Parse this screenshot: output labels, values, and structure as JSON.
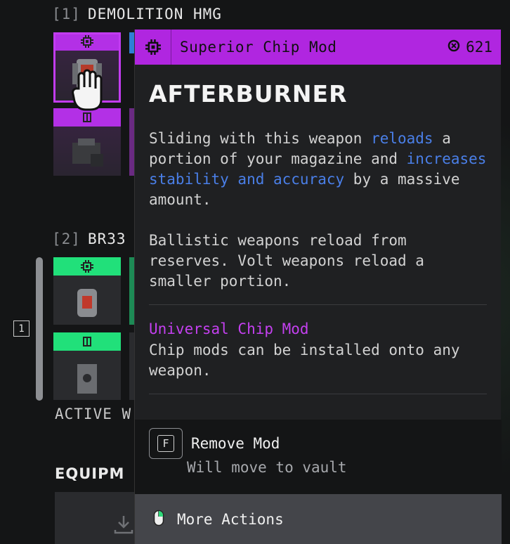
{
  "loadout": {
    "weapon1": {
      "index": "[1]",
      "name": "DEMOLITION HMG"
    },
    "weapon2": {
      "index": "[2]",
      "name": "BR33"
    },
    "active_label": "ACTIVE W",
    "equipment_label": "EQUIPM",
    "page_badge": "1"
  },
  "tooltip": {
    "category": "Superior Chip Mod",
    "cost": "621",
    "title": "AFTERBURNER",
    "desc_part1": "Sliding with this weapon ",
    "desc_hl1": "reloads",
    "desc_part2": " a portion of your magazine and ",
    "desc_hl2": "increases stability and accuracy",
    "desc_part3": " by a massive amount.",
    "desc_para2": "Ballistic weapons reload from reserves. Volt weapons reload a smaller portion.",
    "sub_title": "Universal Chip Mod",
    "sub_desc": "Chip mods can be installed onto any weapon."
  },
  "actions": {
    "remove_key": "F",
    "remove_label": "Remove Mod",
    "remove_sub": "Will move to vault",
    "more_label": "More Actions"
  },
  "colors": {
    "rarity_purple": "#b026e0",
    "slot_green": "#21e07a",
    "highlight_blue": "#4a7fe8"
  }
}
